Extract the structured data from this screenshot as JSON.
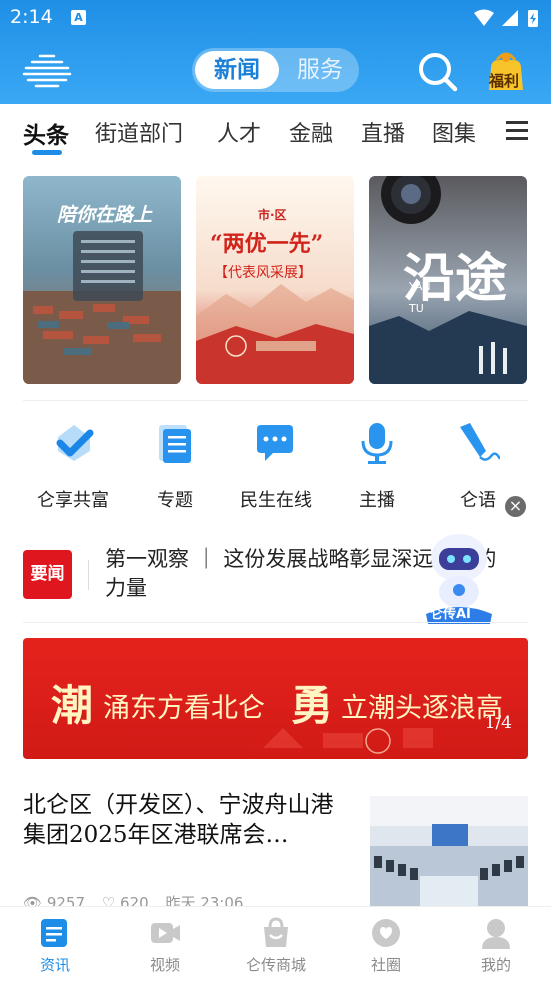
{
  "status_bar": {
    "time": "2:14",
    "notification_badge": "A"
  },
  "header": {
    "toggle_active": "新闻",
    "toggle_inactive": "服务",
    "welfare_label": "福利",
    "colors": {
      "accent": "#1f8fe6"
    }
  },
  "tabs": [
    "头条",
    "街道部门",
    "人才",
    "金融",
    "直播",
    "图集"
  ],
  "banners": [
    {
      "title": "陪你在路上"
    },
    {
      "line1": "市·区",
      "line2": "“两优一先”",
      "line3": "【代表风采展】"
    },
    {
      "title": "沿途",
      "subtitle": "YAN TU"
    }
  ],
  "quick_entries": [
    {
      "label": "仑享共富",
      "icon": "heart-check-icon"
    },
    {
      "label": "专题",
      "icon": "document-icon"
    },
    {
      "label": "民生在线",
      "icon": "chat-bubble-icon"
    },
    {
      "label": "主播",
      "icon": "microphone-icon"
    },
    {
      "label": "仑语",
      "icon": "pen-icon"
    }
  ],
  "headline": {
    "badge": "要闻",
    "text": "第一观察 ｜ 这份发展战略彰显深远持久的力量"
  },
  "assistant": {
    "label": "仑传AI"
  },
  "big_banner": {
    "part1": "潮",
    "part2": "涌东方看北仑",
    "part3": "勇",
    "part4": "立潮头逐浪高",
    "page": "1/4"
  },
  "article": {
    "title": "北仑区（开发区）、宁波舟山港集团2025年区港联席会…",
    "views": "9257",
    "likes": "620",
    "time": "昨天 23:06"
  },
  "bottom_nav": [
    {
      "label": "资讯",
      "icon": "news-icon",
      "active": true
    },
    {
      "label": "视频",
      "icon": "video-icon",
      "active": false
    },
    {
      "label": "仑传商城",
      "icon": "shopping-bag-icon",
      "active": false
    },
    {
      "label": "社圈",
      "icon": "community-icon",
      "active": false
    },
    {
      "label": "我的",
      "icon": "profile-icon",
      "active": false
    }
  ]
}
